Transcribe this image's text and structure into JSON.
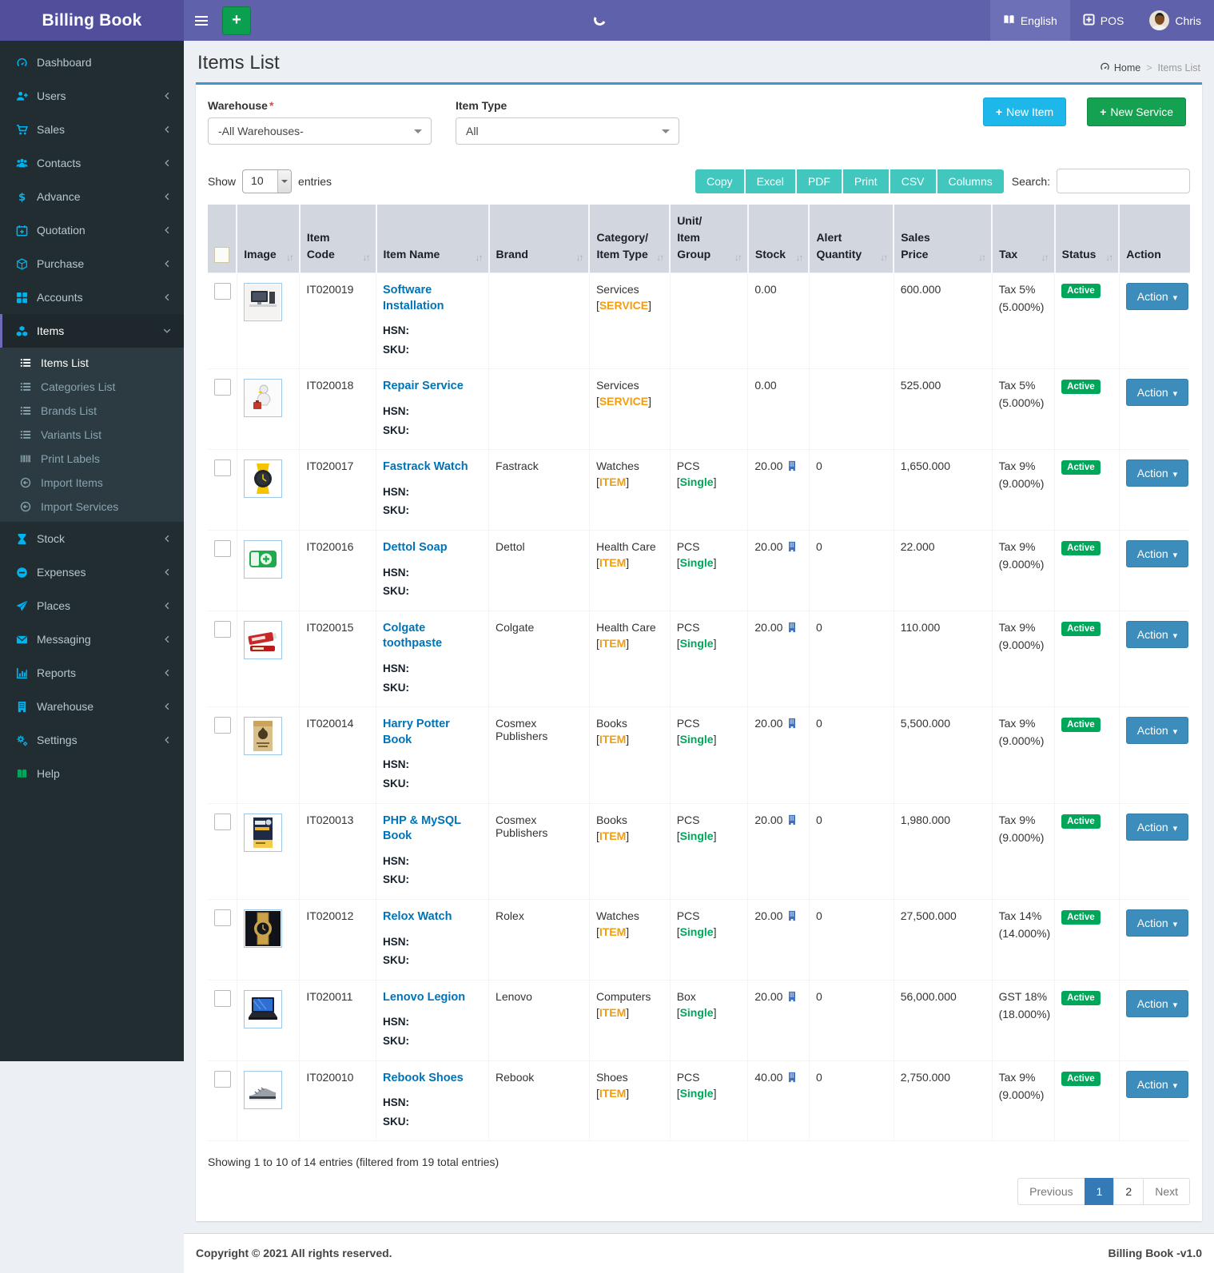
{
  "header": {
    "brand": "Billing Book",
    "language": "English",
    "pos": "POS",
    "user": "Chris"
  },
  "breadcrumb": {
    "home": "Home",
    "separator": ">",
    "current": "Items List"
  },
  "page": {
    "title": "Items List"
  },
  "filters": {
    "warehouse_label": "Warehouse",
    "required_mark": "*",
    "warehouse_value": "-All Warehouses-",
    "item_type_label": "Item Type",
    "item_type_value": "All"
  },
  "actions": {
    "new_item": "New Item",
    "new_service": "New Service"
  },
  "table_controls": {
    "show_label": "Show",
    "page_length": "10",
    "entries_label": "entries",
    "export_buttons": [
      "Copy",
      "Excel",
      "PDF",
      "Print",
      "CSV",
      "Columns"
    ],
    "search_label": "Search:",
    "search_value": ""
  },
  "table": {
    "labels": {
      "hsn": "HSN:",
      "sku": "SKU:"
    },
    "columns": [
      {
        "label": "",
        "sortable": false,
        "type": "checkbox"
      },
      {
        "label": "Image",
        "sortable": true
      },
      {
        "label": "Item Code",
        "sortable": true
      },
      {
        "label": "Item Name",
        "sortable": true
      },
      {
        "label": "Brand",
        "sortable": true
      },
      {
        "label": "Category/Item Type",
        "sortable": true
      },
      {
        "label": "Unit/Item Group",
        "sortable": true
      },
      {
        "label": "Stock",
        "sortable": true
      },
      {
        "label": "Alert Quantity",
        "sortable": true
      },
      {
        "label": "Sales Price",
        "sortable": true
      },
      {
        "label": "Tax",
        "sortable": true
      },
      {
        "label": "Status",
        "sortable": true
      },
      {
        "label": "Action",
        "sortable": false
      }
    ],
    "rows": [
      {
        "code": "IT020019",
        "name": "Software Installation",
        "brand": "",
        "category": "Services",
        "category_tag": "SERVICE",
        "unit": "",
        "unit_tag": "",
        "stock": "0.00",
        "stock_icon": false,
        "alert": "",
        "price": "600.000",
        "tax1": "Tax 5%",
        "tax2": "(5.000%)",
        "status": "Active",
        "action": "Action",
        "thumb": "pc-setup"
      },
      {
        "code": "IT020018",
        "name": "Repair Service",
        "brand": "",
        "category": "Services",
        "category_tag": "SERVICE",
        "unit": "",
        "unit_tag": "",
        "stock": "0.00",
        "stock_icon": false,
        "alert": "",
        "price": "525.000",
        "tax1": "Tax 5%",
        "tax2": "(5.000%)",
        "status": "Active",
        "action": "Action",
        "thumb": "repair"
      },
      {
        "code": "IT020017",
        "name": "Fastrack Watch",
        "brand": "Fastrack",
        "category": "Watches",
        "category_tag": "ITEM",
        "unit": "PCS",
        "unit_tag": "Single",
        "stock": "20.00",
        "stock_icon": true,
        "alert": "0",
        "price": "1,650.000",
        "tax1": "Tax 9%",
        "tax2": "(9.000%)",
        "status": "Active",
        "action": "Action",
        "thumb": "watch-yellow"
      },
      {
        "code": "IT020016",
        "name": "Dettol Soap",
        "brand": "Dettol",
        "category": "Health Care",
        "category_tag": "ITEM",
        "unit": "PCS",
        "unit_tag": "Single",
        "stock": "20.00",
        "stock_icon": true,
        "alert": "0",
        "price": "22.000",
        "tax1": "Tax 9%",
        "tax2": "(9.000%)",
        "status": "Active",
        "action": "Action",
        "thumb": "soap"
      },
      {
        "code": "IT020015",
        "name": "Colgate toothpaste",
        "brand": "Colgate",
        "category": "Health Care",
        "category_tag": "ITEM",
        "unit": "PCS",
        "unit_tag": "Single",
        "stock": "20.00",
        "stock_icon": true,
        "alert": "0",
        "price": "110.000",
        "tax1": "Tax 9%",
        "tax2": "(9.000%)",
        "status": "Active",
        "action": "Action",
        "thumb": "toothpaste"
      },
      {
        "code": "IT020014",
        "name": "Harry Potter Book",
        "brand": "Cosmex Publishers",
        "category": "Books",
        "category_tag": "ITEM",
        "unit": "PCS",
        "unit_tag": "Single",
        "stock": "20.00",
        "stock_icon": true,
        "alert": "0",
        "price": "5,500.000",
        "tax1": "Tax 9%",
        "tax2": "(9.000%)",
        "status": "Active",
        "action": "Action",
        "thumb": "book-tan"
      },
      {
        "code": "IT020013",
        "name": "PHP & MySQL Book",
        "brand": "Cosmex Publishers",
        "category": "Books",
        "category_tag": "ITEM",
        "unit": "PCS",
        "unit_tag": "Single",
        "stock": "20.00",
        "stock_icon": true,
        "alert": "0",
        "price": "1,980.000",
        "tax1": "Tax 9%",
        "tax2": "(9.000%)",
        "status": "Active",
        "action": "Action",
        "thumb": "book-dark"
      },
      {
        "code": "IT020012",
        "name": "Relox Watch",
        "brand": "Rolex",
        "category": "Watches",
        "category_tag": "ITEM",
        "unit": "PCS",
        "unit_tag": "Single",
        "stock": "20.00",
        "stock_icon": true,
        "alert": "0",
        "price": "27,500.000",
        "tax1": "Tax 14%",
        "tax2": "(14.000%)",
        "status": "Active",
        "action": "Action",
        "thumb": "watch-gold"
      },
      {
        "code": "IT020011",
        "name": "Lenovo Legion",
        "brand": "Lenovo",
        "category": "Computers",
        "category_tag": "ITEM",
        "unit": "Box",
        "unit_tag": "Single",
        "stock": "20.00",
        "stock_icon": true,
        "alert": "0",
        "price": "56,000.000",
        "tax1": "GST 18%",
        "tax2": "(18.000%)",
        "status": "Active",
        "action": "Action",
        "thumb": "laptop"
      },
      {
        "code": "IT020010",
        "name": "Rebook Shoes",
        "brand": "Rebook",
        "category": "Shoes",
        "category_tag": "ITEM",
        "unit": "PCS",
        "unit_tag": "Single",
        "stock": "40.00",
        "stock_icon": true,
        "alert": "0",
        "price": "2,750.000",
        "tax1": "Tax 9%",
        "tax2": "(9.000%)",
        "status": "Active",
        "action": "Action",
        "thumb": "shoe"
      }
    ]
  },
  "pagination": {
    "summary": "Showing 1 to 10 of 14 entries (filtered from 19 total entries)",
    "previous": "Previous",
    "pages": [
      "1",
      "2"
    ],
    "active_page": "1",
    "next": "Next"
  },
  "sidebar": {
    "items": [
      {
        "label": "Dashboard",
        "icon": "dashboard-icon"
      },
      {
        "label": "Users",
        "icon": "user-plus-icon",
        "has_children": true
      },
      {
        "label": "Sales",
        "icon": "cart-icon",
        "has_children": true
      },
      {
        "label": "Contacts",
        "icon": "contacts-icon",
        "has_children": true
      },
      {
        "label": "Advance",
        "icon": "dollar-icon",
        "has_children": true
      },
      {
        "label": "Quotation",
        "icon": "calendar-icon",
        "has_children": true
      },
      {
        "label": "Purchase",
        "icon": "cube-icon",
        "has_children": true
      },
      {
        "label": "Accounts",
        "icon": "grid-icon",
        "has_children": true
      },
      {
        "label": "Items",
        "icon": "cubes-icon",
        "has_children": true,
        "expanded": true,
        "active": true,
        "children": [
          {
            "label": "Items List",
            "icon": "list-icon",
            "active": true
          },
          {
            "label": "Categories List",
            "icon": "list-icon"
          },
          {
            "label": "Brands List",
            "icon": "list-icon"
          },
          {
            "label": "Variants List",
            "icon": "list-icon"
          },
          {
            "label": "Print Labels",
            "icon": "barcode-icon"
          },
          {
            "label": "Import Items",
            "icon": "import-icon"
          },
          {
            "label": "Import Services",
            "icon": "import-icon"
          }
        ]
      },
      {
        "label": "Stock",
        "icon": "hourglass-icon",
        "has_children": true
      },
      {
        "label": "Expenses",
        "icon": "minus-circle-icon",
        "has_children": true
      },
      {
        "label": "Places",
        "icon": "paper-plane-icon",
        "has_children": true
      },
      {
        "label": "Messaging",
        "icon": "envelope-icon",
        "has_children": true
      },
      {
        "label": "Reports",
        "icon": "bar-chart-icon",
        "has_children": true
      },
      {
        "label": "Warehouse",
        "icon": "building-icon",
        "has_children": true
      },
      {
        "label": "Settings",
        "icon": "gears-icon",
        "has_children": true
      },
      {
        "label": "Help",
        "icon": "help-book-icon",
        "icon_color": "#00a65a"
      }
    ]
  },
  "footer": {
    "copyright": "Copyright © 2021 All rights reserved.",
    "version": "Billing Book -v1.0"
  },
  "colors": {
    "navbar_purple": "#5f61ab",
    "logo_purple": "#514f9c",
    "sidebar_dark": "#222d32",
    "box_accent_blue": "#3c97cf",
    "new_item_blue": "#1db7ea",
    "new_service_green": "#14a151",
    "export_teal": "#41c7bd",
    "link_blue": "#0073b7",
    "tag_orange": "#f39c12",
    "tag_green": "#00a65a",
    "badge_green": "#00a65a",
    "action_blue": "#3c8dbc",
    "active_page_blue": "#337ab7",
    "stock_icon_blue": "#3b6fc0"
  }
}
